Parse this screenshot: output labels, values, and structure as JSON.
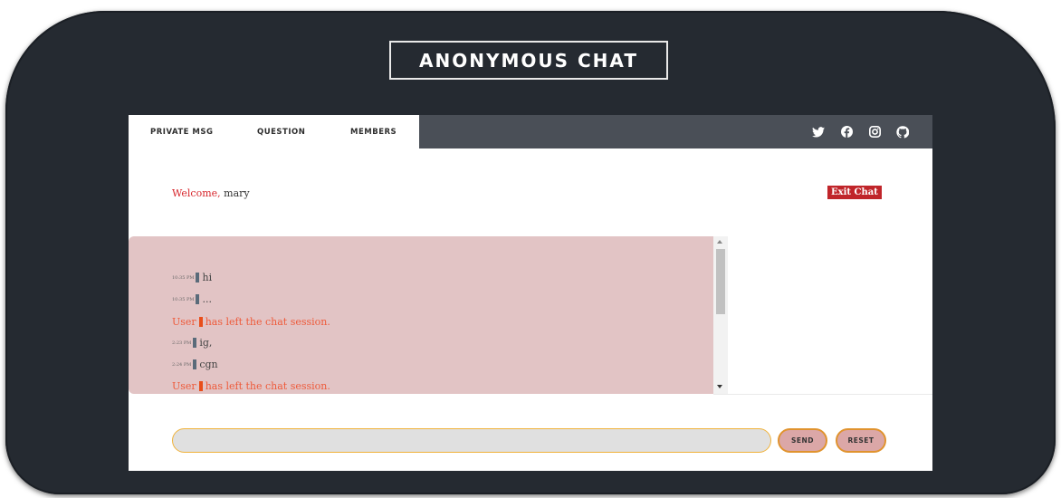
{
  "app_title": "ANONYMOUS CHAT",
  "tabs": [
    {
      "label": "PRIVATE MSG"
    },
    {
      "label": "QUESTION"
    },
    {
      "label": "MEMBERS"
    }
  ],
  "socials": [
    "twitter-icon",
    "facebook-icon",
    "instagram-icon",
    "github-icon"
  ],
  "welcome": {
    "greeting": "Welcome,",
    "username": "mary"
  },
  "exit_label": "Exit Chat",
  "messages": [
    {
      "time": "10:35 PM",
      "text": "hi"
    },
    {
      "time": "10:35 PM",
      "text": "..."
    },
    {
      "user": "User",
      "text": "has left the chat session."
    },
    {
      "time": "2:23 PM",
      "text": "ig,"
    },
    {
      "time": "2:24 PM",
      "text": "cgn"
    },
    {
      "user": "User",
      "text": "has left the chat session."
    }
  ],
  "input": {
    "value": "",
    "placeholder": ""
  },
  "send_label": "SEND",
  "reset_label": "RESET",
  "colors": {
    "background": "#252a31",
    "navbar": "#4a4f57",
    "chat_bg": "#e2c4c5",
    "accent_red": "#c0252a",
    "system_text": "#ee5a3a",
    "button_border": "#e0932e"
  }
}
